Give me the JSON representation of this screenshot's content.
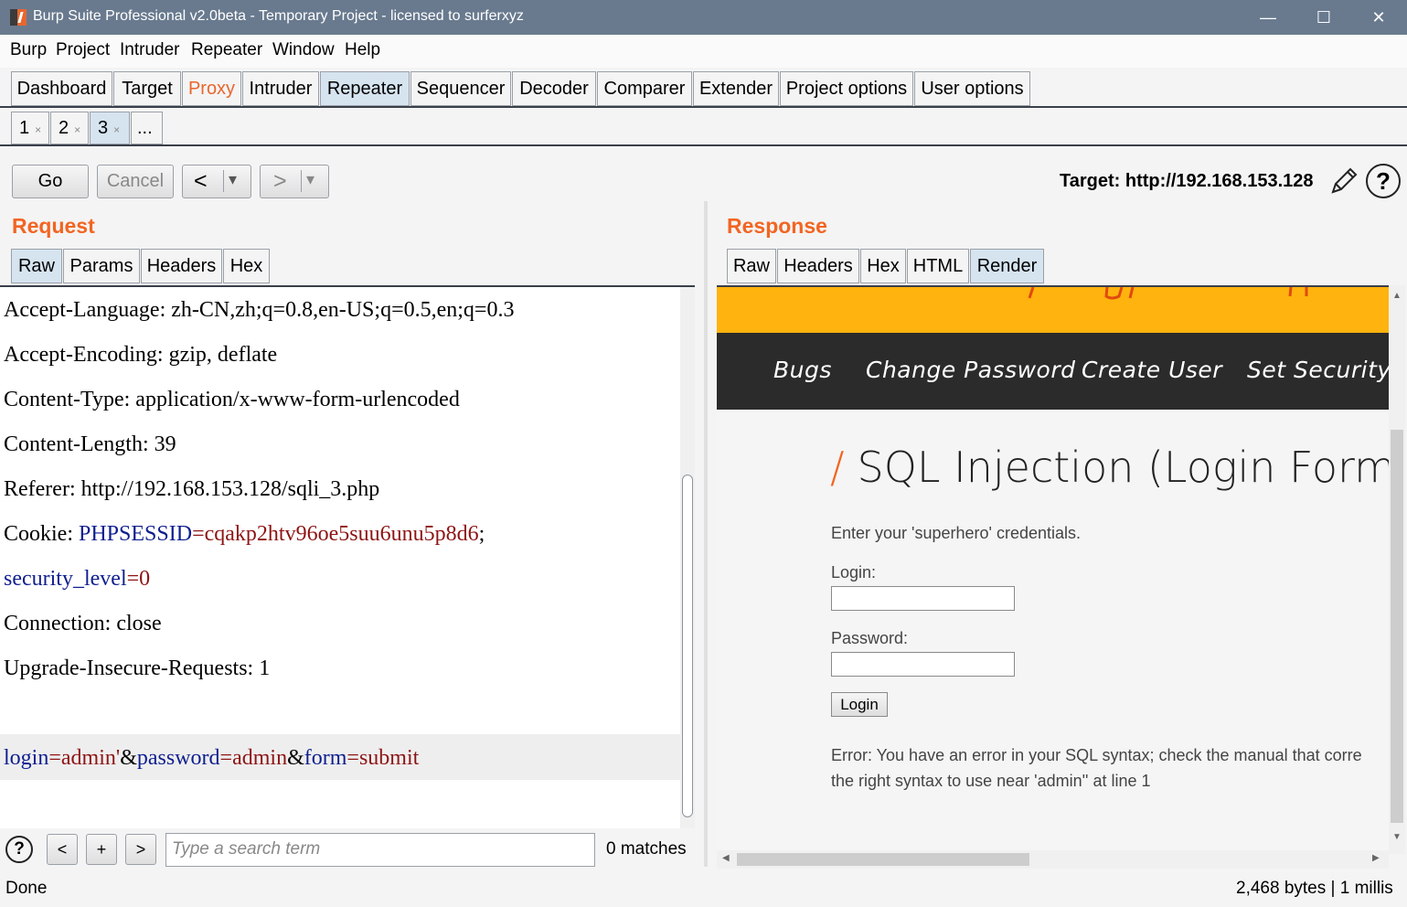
{
  "window": {
    "title": "Burp Suite Professional v2.0beta - Temporary Project - licensed to surferxyz",
    "minimize": "—",
    "maximize": "☐",
    "close": "✕"
  },
  "menu": [
    "Burp",
    "Project",
    "Intruder",
    "Repeater",
    "Window",
    "Help"
  ],
  "main_tabs": [
    "Dashboard",
    "Target",
    "Proxy",
    "Intruder",
    "Repeater",
    "Sequencer",
    "Decoder",
    "Comparer",
    "Extender",
    "Project options",
    "User options"
  ],
  "sub_tabs": [
    "1",
    "2",
    "3",
    "..."
  ],
  "sub_tab_close": "×",
  "toolbar": {
    "go": "Go",
    "cancel": "Cancel",
    "back": "<",
    "forward": ">",
    "dropdown": "▾",
    "target": "Target: http://192.168.153.128",
    "help": "?"
  },
  "request": {
    "title": "Request",
    "tabs": [
      "Raw",
      "Params",
      "Headers",
      "Hex"
    ],
    "lines": {
      "accept_language": "Accept-Language: zh-CN,zh;q=0.8,en-US;q=0.5,en;q=0.3",
      "accept_encoding": "Accept-Encoding: gzip, deflate",
      "content_type": "Content-Type: application/x-www-form-urlencoded",
      "content_length": "Content-Length: 39",
      "referer": "Referer: http://192.168.153.128/sqli_3.php",
      "cookie_prefix": "Cookie: ",
      "cookie_key": "PHPSESSID",
      "eq": "=",
      "cookie_val": "cqakp2htv96oe5suu6unu5p8d6",
      "semicolon": ";",
      "sec_key": "security_level",
      "sec_val": "0",
      "connection": "Connection: close",
      "upgrade": "Upgrade-Insecure-Requests: 1",
      "body_k1": "login",
      "body_v1": "admin'",
      "amp": "&",
      "body_k2": "password",
      "body_v2": "admin",
      "body_k3": "form",
      "body_v3": "submit"
    },
    "search": {
      "help": "?",
      "prev": "<",
      "add": "+",
      "next": ">",
      "placeholder": "Type a search term",
      "matches": "0 matches"
    }
  },
  "response": {
    "title": "Response",
    "tabs": [
      "Raw",
      "Headers",
      "Hex",
      "HTML",
      "Render"
    ],
    "render": {
      "nav": [
        "Bugs",
        "Change Password",
        "Create User",
        "Set Security L"
      ],
      "slash": "/",
      "heading": "SQL Injection (Login Form",
      "intro": "Enter your 'superhero' credentials.",
      "login_label": "Login:",
      "password_label": "Password:",
      "login_button": "Login",
      "error_line1": "Error: You have an error in your SQL syntax; check the manual that corre",
      "error_line2": "the right syntax to use near 'admin'' at line 1"
    }
  },
  "status": {
    "left": "Done",
    "right": "2,468 bytes | 1 millis"
  }
}
